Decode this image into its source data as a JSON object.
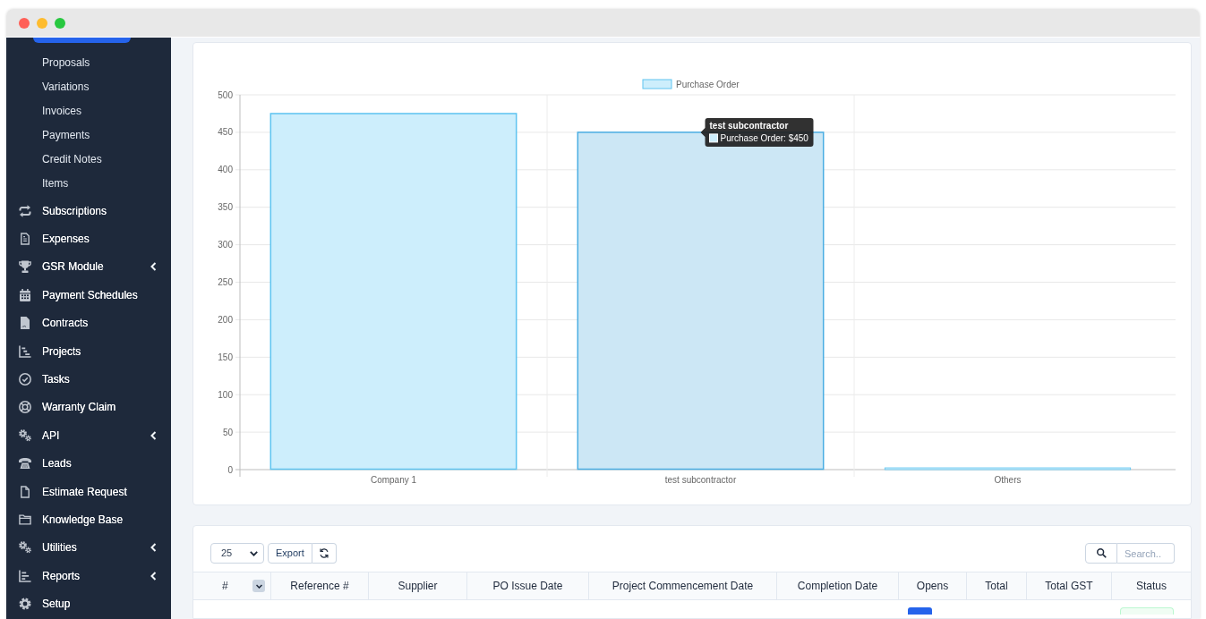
{
  "sidebar": {
    "active_item_above": true,
    "submenu_items": [
      {
        "label": "Proposals",
        "selected": false
      },
      {
        "label": "Variations",
        "selected": false
      },
      {
        "label": "Invoices",
        "selected": false
      },
      {
        "label": "Payments",
        "selected": false
      },
      {
        "label": "Credit Notes",
        "selected": false
      },
      {
        "label": "Items",
        "selected": false
      }
    ],
    "items": [
      {
        "label": "Subscriptions",
        "has_submenu": false,
        "selected": false
      },
      {
        "label": "Expenses",
        "has_submenu": false,
        "selected": false
      },
      {
        "label": "GSR Module",
        "has_submenu": true,
        "selected": false
      },
      {
        "label": "Payment Schedules",
        "has_submenu": false,
        "selected": false
      },
      {
        "label": "Contracts",
        "has_submenu": false,
        "selected": false
      },
      {
        "label": "Projects",
        "has_submenu": false,
        "selected": false
      },
      {
        "label": "Tasks",
        "has_submenu": false,
        "selected": false
      },
      {
        "label": "Warranty Claim",
        "has_submenu": false,
        "selected": false
      },
      {
        "label": "API",
        "has_submenu": true,
        "selected": false
      },
      {
        "label": "Leads",
        "has_submenu": false,
        "selected": false
      },
      {
        "label": "Estimate Request",
        "has_submenu": false,
        "selected": false
      },
      {
        "label": "Knowledge Base",
        "has_submenu": false,
        "selected": false
      },
      {
        "label": "Utilities",
        "has_submenu": true,
        "selected": false
      },
      {
        "label": "Reports",
        "has_submenu": true,
        "selected": false
      },
      {
        "label": "Setup",
        "has_submenu": false,
        "selected": false
      }
    ]
  },
  "chart_card": {
    "chart_data": {
      "type": "bar",
      "categories": [
        "Company 1",
        "test subcontractor",
        "Others"
      ],
      "series": [
        {
          "name": "Purchase Order",
          "color": "#cdeefc",
          "values": [
            475,
            450,
            0
          ]
        }
      ],
      "ylim": [
        0,
        500
      ],
      "yticks": [
        0,
        50,
        100,
        150,
        200,
        250,
        300,
        350,
        400,
        450,
        500
      ],
      "grid": true
    },
    "bars": [
      {
        "hovered": false
      },
      {
        "hovered": true
      },
      {
        "hovered": false
      }
    ],
    "tooltip": {
      "title": "test subcontractor",
      "label": "Purchase Order: $450"
    }
  },
  "table_card": {
    "page_length": "25",
    "buttons": [
      {
        "kind": "text",
        "label": "Export"
      },
      {
        "kind": "refresh"
      }
    ],
    "search": {
      "placeholder": "Search.."
    },
    "columns": [
      {
        "label": "#",
        "toggle": true
      },
      {
        "label": "Reference #",
        "toggle": false
      },
      {
        "label": "Supplier",
        "toggle": false
      },
      {
        "label": "PO Issue Date",
        "toggle": false
      },
      {
        "label": "Project Commencement Date",
        "toggle": false
      },
      {
        "label": "Completion Date",
        "toggle": false
      },
      {
        "label": "Opens",
        "toggle": false
      },
      {
        "label": "Total",
        "toggle": false
      },
      {
        "label": "Total GST",
        "toggle": false
      },
      {
        "label": "Status",
        "toggle": false
      }
    ]
  }
}
